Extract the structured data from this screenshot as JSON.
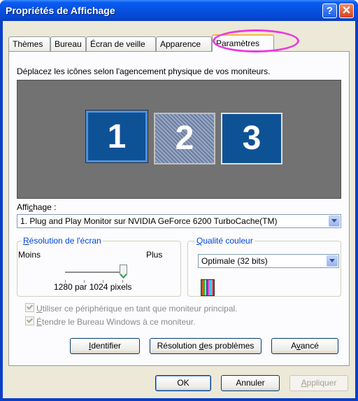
{
  "window": {
    "title": "Propriétés de Affichage",
    "help_label": "?",
    "close_label": "✕"
  },
  "tabs": [
    {
      "label": "Thèmes"
    },
    {
      "label": "Bureau"
    },
    {
      "label": "Écran de veille"
    },
    {
      "label": "Apparence"
    },
    {
      "label": "Paramètres"
    }
  ],
  "settings": {
    "instruction": "Déplacez les icônes selon l'agencement physique de vos moniteurs.",
    "monitors": [
      "1",
      "2",
      "3"
    ],
    "display_label_pre": "Affi",
    "display_label_key": "c",
    "display_label_post": "hage :",
    "display_value": "1. Plug and Play Monitor sur NVIDIA GeForce 6200 TurboCache(TM)",
    "resolution_group": {
      "key": "R",
      "rest": "ésolution de l'écran",
      "less": "Moins",
      "more": "Plus",
      "value": "1280 par 1024 pixels",
      "level_percent": 100
    },
    "color_group": {
      "key": "Q",
      "rest": "ualité couleur",
      "value": "Optimale (32 bits)"
    },
    "color_bar": [
      "#f23b14",
      "#1fb53a",
      "#f3d82a",
      "#2b3fd9",
      "#e441d2",
      "#31d0e8",
      "#ff8d12",
      "#7a2cf0"
    ],
    "checkbox_primary": {
      "key": "U",
      "rest": "tiliser ce périphérique en tant que moniteur principal."
    },
    "checkbox_extend": {
      "key": "É",
      "rest": "tendre le Bureau Windows à ce moniteur."
    },
    "buttons": {
      "identify_pre": "",
      "identify_key": "I",
      "identify_post": "dentifier",
      "troubleshoot_pre": "Résolution ",
      "troubleshoot_key": "d",
      "troubleshoot_post": "es problèmes",
      "advanced_pre": "A",
      "advanced_key": "v",
      "advanced_post": "ancé"
    }
  },
  "dialog_buttons": {
    "ok": "OK",
    "cancel": "Annuler",
    "apply_key": "A",
    "apply_rest": "ppliquer"
  }
}
